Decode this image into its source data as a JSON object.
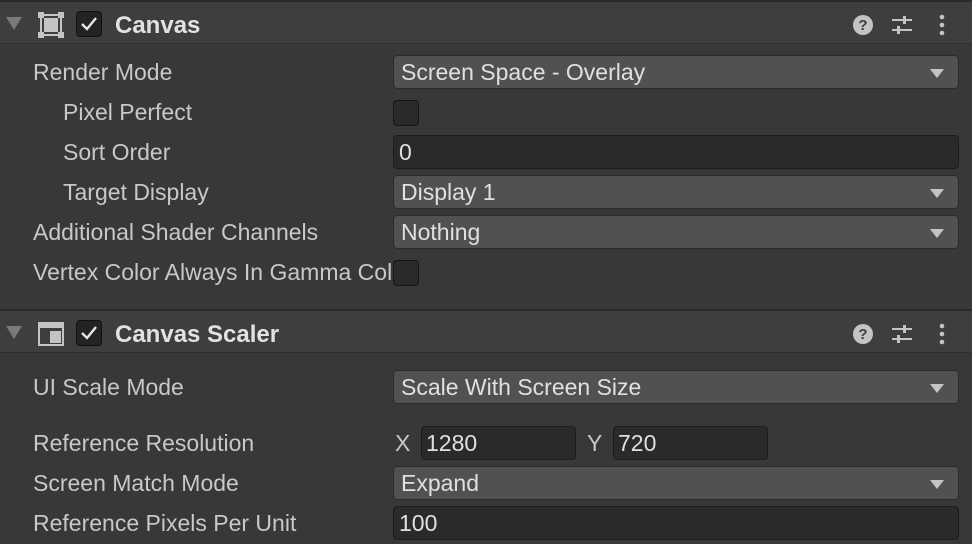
{
  "canvas": {
    "title": "Canvas",
    "enabled": true,
    "fields": {
      "render_mode": {
        "label": "Render Mode",
        "value": "Screen Space - Overlay"
      },
      "pixel_perfect": {
        "label": "Pixel Perfect",
        "checked": false
      },
      "sort_order": {
        "label": "Sort Order",
        "value": "0"
      },
      "target_display": {
        "label": "Target Display",
        "value": "Display 1"
      },
      "additional_shader_channels": {
        "label": "Additional Shader Channels",
        "value": "Nothing"
      },
      "vertex_color_gamma": {
        "label": "Vertex Color Always In Gamma Color Space",
        "checked": false
      }
    }
  },
  "canvas_scaler": {
    "title": "Canvas Scaler",
    "enabled": true,
    "fields": {
      "ui_scale_mode": {
        "label": "UI Scale Mode",
        "value": "Scale With Screen Size"
      },
      "reference_resolution": {
        "label": "Reference Resolution",
        "x_label": "X",
        "x": "1280",
        "y_label": "Y",
        "y": "720"
      },
      "screen_match_mode": {
        "label": "Screen Match Mode",
        "value": "Expand"
      },
      "reference_pixels_per_unit": {
        "label": "Reference Pixels Per Unit",
        "value": "100"
      }
    }
  },
  "icons": [
    "foldout-arrow-icon",
    "rect-transform-icon",
    "canvas-scaler-icon",
    "checkmark-icon",
    "help-icon",
    "presets-icon",
    "more-icon"
  ],
  "colors": {
    "background": "#383838",
    "header": "#3e3e3e",
    "dropdown": "#515151",
    "field": "#2a2a2a",
    "text": "#c8c8c8"
  }
}
